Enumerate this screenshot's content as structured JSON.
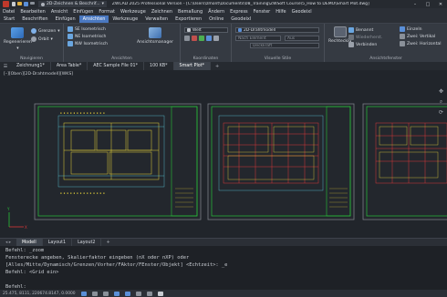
{
  "window": {
    "title": "ZWCAD 2025 Professional Version - [C:\\Users\\zmont\\Documents\\08_Training\\ZWSoft Course\\5_How to DEMO\\Smart Plot.dwg]",
    "quick_tab": "2D-Zeichnen & Beschrif...",
    "controls": [
      "–",
      "□",
      "✕"
    ]
  },
  "menu": [
    "Datei",
    "Bearbeiten",
    "Ansicht",
    "Einfügen",
    "Format",
    "Werkzeuge",
    "Zeichnen",
    "Bemaßung",
    "Ändern",
    "Express",
    "Fenster",
    "Hilfe",
    "Geodeixl"
  ],
  "ribbon_tabs": [
    "Start",
    "Beschriften",
    "Einfügen",
    "Ansichten",
    "Werkzeuge",
    "Verwalten",
    "Exportieren",
    "Online",
    "Geodeixl"
  ],
  "ribbon_active_tab": "Ansichten",
  "ribbon": {
    "navigieren": {
      "label": "Navigieren",
      "regenerieren": "Regenerieren",
      "grenzen": "Grenzen",
      "orbit": "Orbit"
    },
    "ansichten": {
      "label": "Ansichten",
      "items": [
        "SE Isometrisch",
        "NE Isometrisch",
        "NW Isometrisch"
      ],
      "manager": "Ansichtsmanager"
    },
    "koordinaten": {
      "label": "Koordinaten",
      "world": "Welt"
    },
    "visuelle_stile": {
      "label": "Visuelle Stile",
      "style": "2D-Drahtmodell",
      "fields": [
        "Nach Element",
        "Aus",
        "Deckkraft"
      ]
    },
    "ansichtsfenster": {
      "label": "Ansichtsfenster",
      "bereich": "Rechteckig",
      "benannt": "Benannt",
      "verbinden": "Verbinden",
      "zusammenf": "Zusammenfügen",
      "wiederherst": "Wiederherst.",
      "splits": [
        "Ein:",
        "Einzeln",
        "Zwei: Vertikal",
        "Zwei: Horizontal"
      ]
    }
  },
  "doc_tabs": [
    "Zeichnung1*",
    "Area Table*",
    "AEC Sample File 01*",
    "100 KB*",
    "Smart Plot*"
  ],
  "doc_active": "Smart Plot*",
  "viewport_label": "[–][Oben][2D-Drahtmodell][WKS]",
  "layout_tabs": [
    "Modell",
    "Layout1",
    "Layout2"
  ],
  "command_lines": [
    "Befehl: _zoom",
    "Fensterecke angeben, Skalierfaktor eingeben (nX oder nXP) oder",
    "[Alles/Mitte/Dynamisch/Grenzen/Vorher/FAktor/FEnster/Objekt] <Echtzeit>: _e",
    "Befehl: <Grid ein>",
    "",
    "Befehl:"
  ],
  "status": {
    "coords": "25.475, 8111, 220674.8147, 0.0000",
    "icons": [
      "grid",
      "snap",
      "ortho",
      "polar",
      "osnap",
      "otrack",
      "lwt",
      "model"
    ]
  },
  "colors": {
    "accent": "#4a78c0",
    "drawing_green": "#29c23a",
    "drawing_yellow": "#e6d23a",
    "drawing_red": "#d8383a"
  }
}
